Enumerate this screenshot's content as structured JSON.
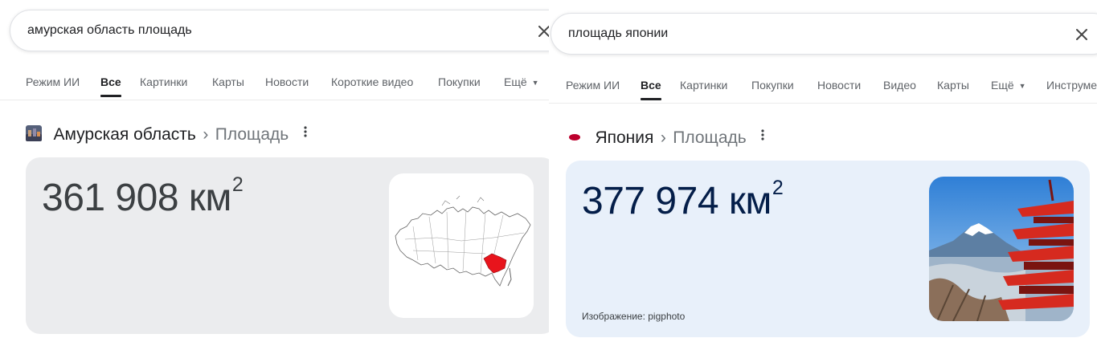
{
  "left": {
    "search": {
      "query": "амурская область площадь"
    },
    "tabs": [
      {
        "label": "Режим ИИ"
      },
      {
        "label": "Все"
      },
      {
        "label": "Картинки"
      },
      {
        "label": "Карты"
      },
      {
        "label": "Новости"
      },
      {
        "label": "Короткие видео"
      },
      {
        "label": "Покупки"
      },
      {
        "label": "Ещё"
      }
    ],
    "active_tab": "Все",
    "breadcrumb": {
      "entity": "Амурская область",
      "separator": "›",
      "attribute": "Площадь"
    },
    "answer": {
      "value": "361 908 км",
      "unit_exponent": "2"
    },
    "image": {
      "icon": "russia-map-amur-highlight",
      "highlight_color": "#e8141c"
    }
  },
  "right": {
    "search": {
      "query": "площадь японии"
    },
    "tabs": [
      {
        "label": "Режим ИИ"
      },
      {
        "label": "Все"
      },
      {
        "label": "Картинки"
      },
      {
        "label": "Покупки"
      },
      {
        "label": "Новости"
      },
      {
        "label": "Видео"
      },
      {
        "label": "Карты"
      },
      {
        "label": "Ещё"
      },
      {
        "label": "Инструме"
      }
    ],
    "active_tab": "Все",
    "breadcrumb": {
      "entity": "Япония",
      "separator": "›",
      "attribute": "Площадь"
    },
    "answer": {
      "value": "377 974 км",
      "unit_exponent": "2"
    },
    "image": {
      "icon": "mount-fuji-pagoda-photo",
      "credit": "Изображение: pigphoto"
    },
    "flag_color": "#bc002d"
  },
  "colors": {
    "card_left": "#ebecee",
    "card_right": "#e8f0fa",
    "text_right_value": "#041e49"
  }
}
